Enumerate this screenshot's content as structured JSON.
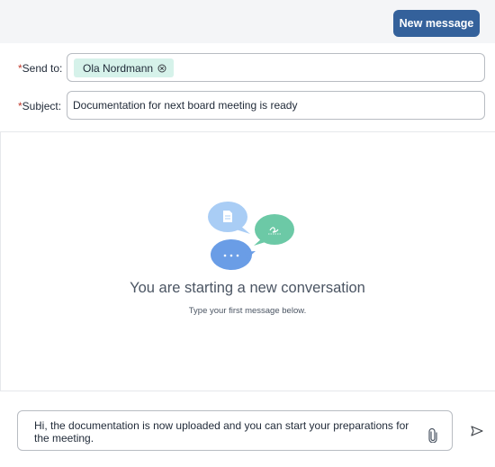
{
  "header": {
    "new_message_label": "New message"
  },
  "form": {
    "send_to_required_mark": "*",
    "send_to_label": "Send to:",
    "recipients": [
      {
        "name": "Ola Nordmann"
      }
    ],
    "subject_required_mark": "*",
    "subject_label": "Subject:",
    "subject_value": "Documentation for next board meeting is ready"
  },
  "empty_state": {
    "title": "You are starting a new conversation",
    "subtitle": "Type your first message below."
  },
  "composer": {
    "message_text": "Hi, the documentation is now uploaded and you can start your preparations for the meeting."
  },
  "icons": {
    "recipient_remove": "close-circle-icon",
    "attach": "paperclip-icon",
    "send": "send-icon",
    "bubble_document": "document-bubble-icon",
    "bubble_signature": "signature-bubble-icon",
    "bubble_typing": "typing-bubble-icon"
  },
  "colors": {
    "primary_button": "#34619b",
    "chip_background": "#d6f2ea",
    "required_asterisk": "#c0392b",
    "bubble_light_blue": "#a9cdf5",
    "bubble_green": "#6cc9a6",
    "bubble_blue": "#6a9de6"
  }
}
